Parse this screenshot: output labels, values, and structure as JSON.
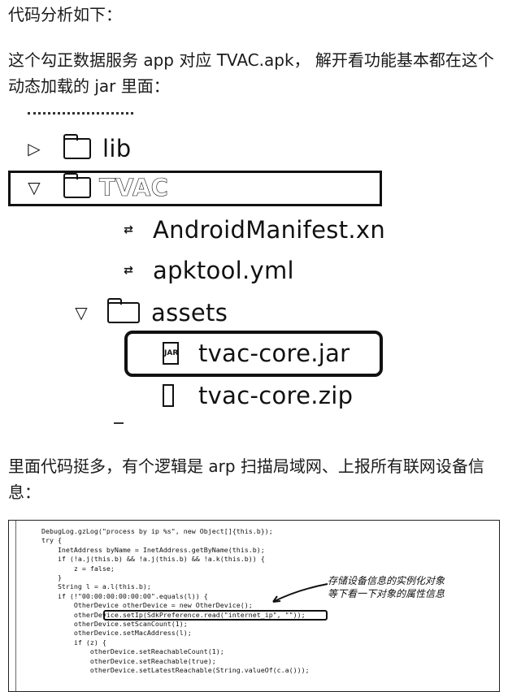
{
  "intro": "代码分析如下：",
  "paragraph1": "这个勾正数据服务 app 对应 TVAC.apk， 解开看功能基本都在这个动态加载的 jar 里面：",
  "tree": {
    "lib": "lib",
    "tvac": "TVAC",
    "manifest": "AndroidManifest.xn",
    "apktool": "apktool.yml",
    "assets": "assets",
    "jar": "tvac-core.jar",
    "zip": "tvac-core.zip",
    "jar_icon_text": "JAR"
  },
  "paragraph2": "里面代码挺多，有个逻辑是 arp 扫描局域网、上报所有联网设备信息：",
  "code": {
    "lines": "        DebugLog.gzLog(\"process by ip %s\", new Object[]{this.b});\n        try {\n            InetAddress byName = InetAddress.getByName(this.b);\n            if (!a.j(this.b) && !a.j(this.b) && !a.k(this.b)) {\n                z = false;\n            }\n            String l = a.l(this.b);\n            if (!\"00:00:00:00:00:00\".equals(l)) {\n                OtherDevice otherDevice = new OtherDevice();\n                otherDevice.setIp(SdkPreference.read(\"internet_ip\", \"\"));\n                otherDevice.setScanCount(1);\n                otherDevice.setMacAddress(l);\n                if (z) {\n                    otherDevice.setReachableCount(1);\n                    otherDevice.setReachable(true);\n                    otherDevice.setLatestReachable(String.valueOf(c.a()));",
    "annotation_line1": "存储设备信息的实例化对象",
    "annotation_line2": "等下看一下对象的属性信息"
  }
}
